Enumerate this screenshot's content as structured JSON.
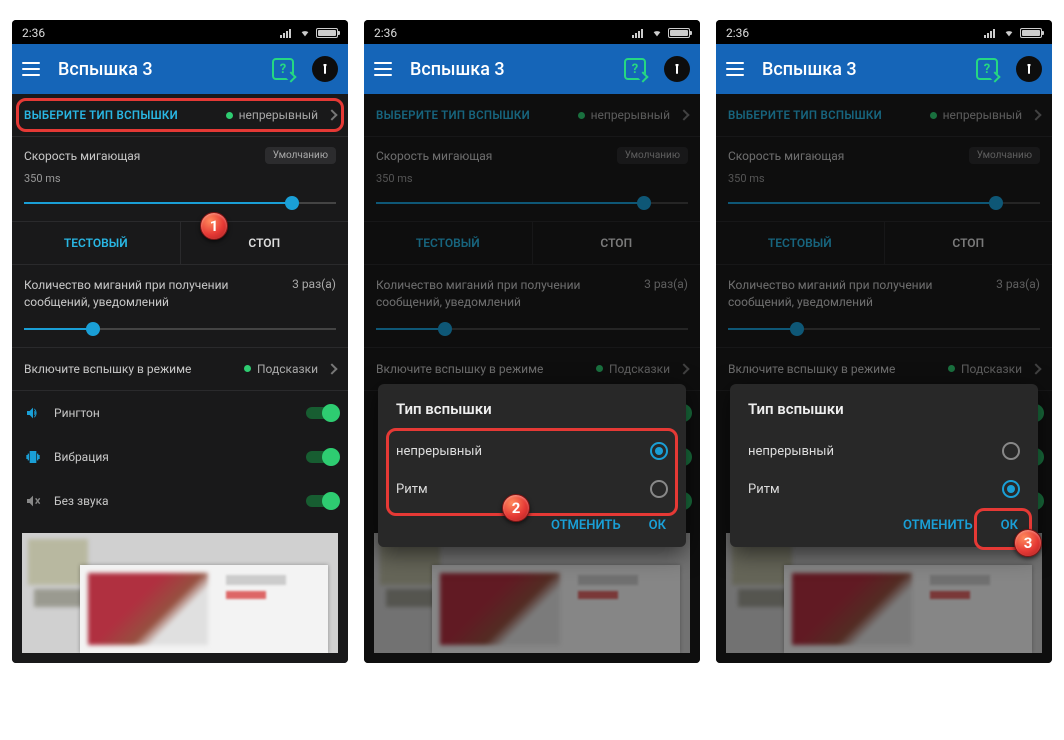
{
  "status": {
    "time": "2:36"
  },
  "appbar": {
    "title": "Вспышка 3"
  },
  "type_row": {
    "label": "ВЫБЕРИТЕ ТИП ВСПЫШКИ",
    "value": "непрерывный"
  },
  "speed": {
    "label": "Скорость мигающая",
    "default_btn": "Умолчанию",
    "ms": "350 ms"
  },
  "teststop": {
    "test": "ТЕСТОВЫЙ",
    "stop": "СТОП"
  },
  "count": {
    "label": "Количество миганий при получении сообщений, уведомлений",
    "value": "3 раз(а)"
  },
  "mode": {
    "label": "Включите вспышку в режиме",
    "value": "Подсказки"
  },
  "switches": {
    "ringtone": "Рингтон",
    "vibration": "Вибрация",
    "silent": "Без звука"
  },
  "dialog": {
    "title": "Тип вспышки",
    "opt1": "непрерывный",
    "opt2": "Ритм",
    "cancel": "ОТМЕНИТЬ",
    "ok": "ОК"
  },
  "badges": {
    "b1": "1",
    "b2": "2",
    "b3": "3"
  }
}
